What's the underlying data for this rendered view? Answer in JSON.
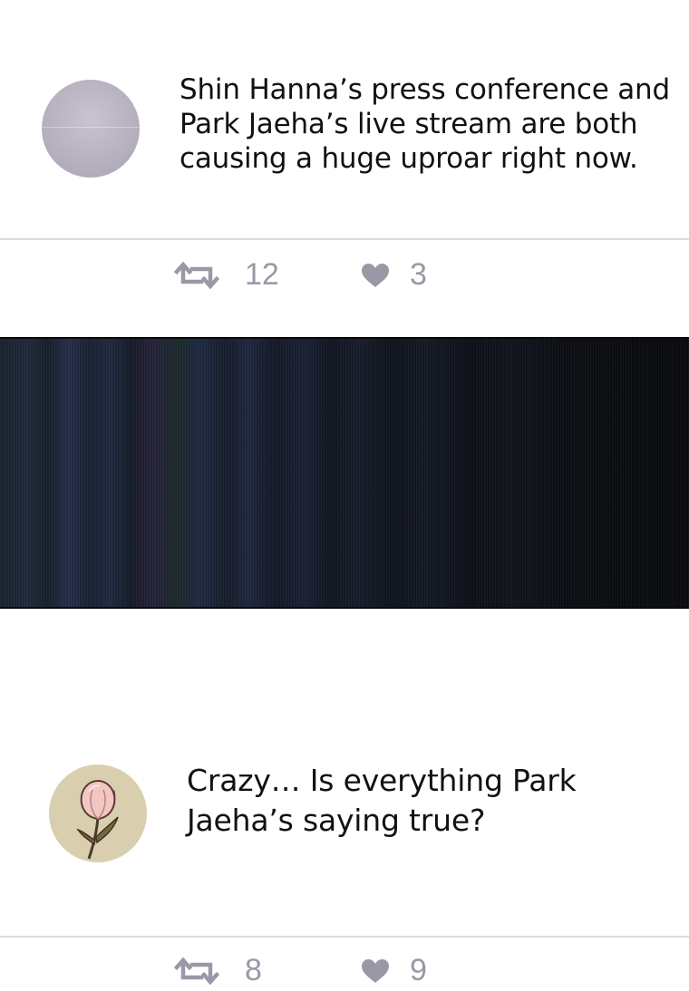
{
  "posts": [
    {
      "text": "Shin Hanna’s press conference and Park Jaeha’s live stream are both causing a huge uproar right now.",
      "retweets": "12",
      "likes": "3"
    },
    {
      "text": "Crazy… Is everything Park Jaeha’s saying true?",
      "retweets": "8",
      "likes": "9"
    }
  ],
  "icons": {
    "retweet": "retweet-icon",
    "like": "heart-icon"
  },
  "colors": {
    "background": "#ffffff",
    "text": "#111111",
    "action_gray": "#9a98a6",
    "divider": "#dcdce0",
    "panel_dark": "#0a0b10"
  }
}
